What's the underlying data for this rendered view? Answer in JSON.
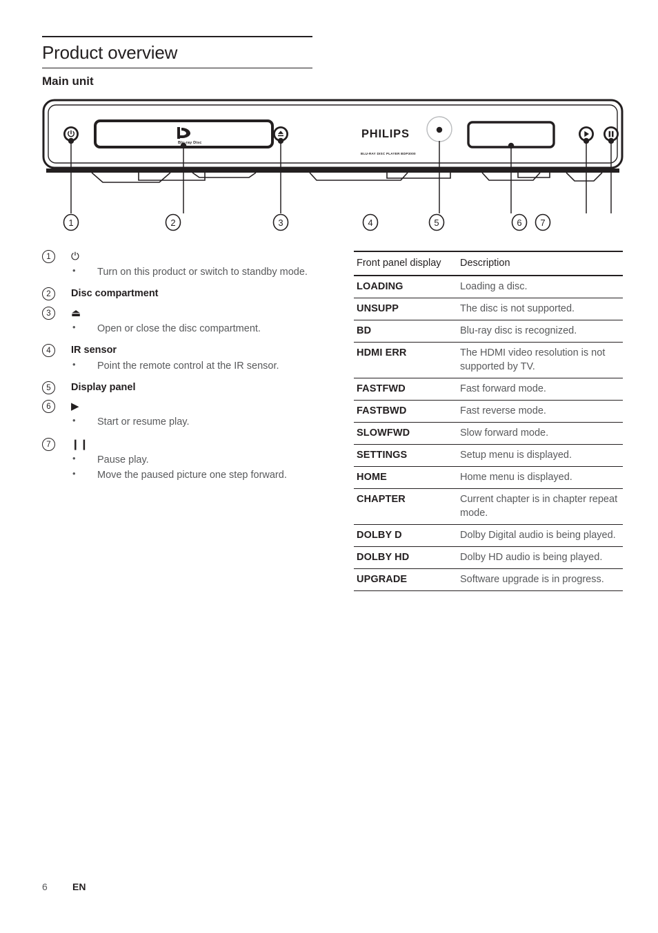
{
  "document": {
    "section_title": "Product overview",
    "subsection_title": "Main unit",
    "footer": {
      "page_number": "6",
      "language": "EN"
    }
  },
  "product_figure": {
    "brand_logo": "PHILIPS",
    "model_label": "BLU-RAY DISC PLAYER BDP3000",
    "disc_logo": "Blu-ray Disc",
    "callout_numbers": [
      "1",
      "2",
      "3",
      "4",
      "5",
      "6",
      "7"
    ]
  },
  "callouts": [
    {
      "number": "1",
      "title": "⏻",
      "is_symbol": true,
      "bullets": [
        "Turn on this product or switch to standby mode."
      ]
    },
    {
      "number": "2",
      "title": "Disc compartment",
      "is_symbol": false,
      "bullets": []
    },
    {
      "number": "3",
      "title": "⏏",
      "is_symbol": true,
      "bullets": [
        "Open or close the disc compartment."
      ]
    },
    {
      "number": "4",
      "title": "IR sensor",
      "is_symbol": false,
      "bullets": [
        "Point the remote control at the IR sensor."
      ]
    },
    {
      "number": "5",
      "title": "Display panel",
      "is_symbol": false,
      "bullets": []
    },
    {
      "number": "6",
      "title": "▶",
      "is_symbol": true,
      "bullets": [
        "Start or resume play."
      ]
    },
    {
      "number": "7",
      "title": "❙❙",
      "is_symbol": true,
      "bullets": [
        "Pause play.",
        "Move the paused picture one step forward."
      ]
    }
  ],
  "table": {
    "headers": [
      "Front panel display",
      "Description"
    ],
    "rows": [
      {
        "code": "LOADING",
        "description": "Loading a disc."
      },
      {
        "code": "UNSUPP",
        "description": "The disc is not supported."
      },
      {
        "code": "BD",
        "description": "Blu-ray disc is recognized."
      },
      {
        "code": "HDMI ERR",
        "description": "The HDMI video resolution is not supported by TV."
      },
      {
        "code": "FASTFWD",
        "description": "Fast forward mode."
      },
      {
        "code": "FASTBWD",
        "description": "Fast reverse mode."
      },
      {
        "code": "SLOWFWD",
        "description": "Slow forward mode."
      },
      {
        "code": "SETTINGS",
        "description": "Setup menu is displayed."
      },
      {
        "code": "HOME",
        "description": "Home menu is displayed."
      },
      {
        "code": "CHAPTER",
        "description": "Current chapter is in chapter repeat mode."
      },
      {
        "code": "DOLBY D",
        "description": "Dolby Digital audio is being played."
      },
      {
        "code": "DOLBY HD",
        "description": "Dolby HD audio is being played."
      },
      {
        "code": "UPGRADE",
        "description": "Software upgrade is in progress."
      }
    ]
  },
  "colors": {
    "text": "#231f20",
    "muted_text": "#58595b",
    "rule": "#231f20"
  }
}
